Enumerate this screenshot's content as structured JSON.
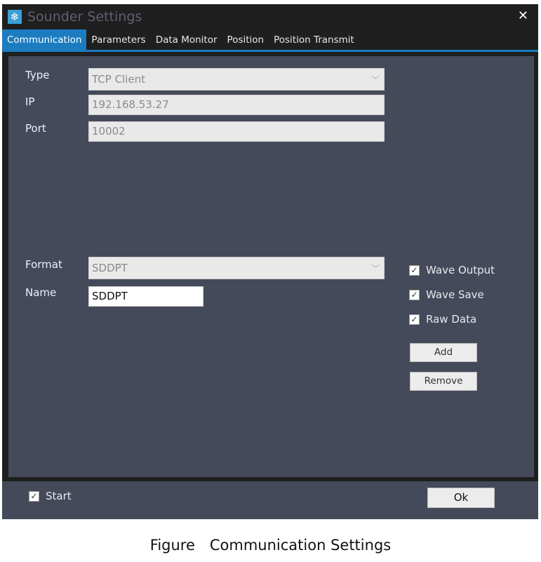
{
  "window": {
    "title": "Sounder Settings",
    "close": "✕",
    "icon": "❄"
  },
  "tabs": [
    {
      "label": "Communication"
    },
    {
      "label": "Parameters"
    },
    {
      "label": "Data Monitor"
    },
    {
      "label": "Position"
    },
    {
      "label": "Position Transmit"
    }
  ],
  "form": {
    "type_label": "Type",
    "type_value": "TCP Client",
    "ip_label": "IP",
    "ip_value": "192.168.53.27",
    "port_label": "Port",
    "port_value": "10002",
    "format_label": "Format",
    "format_value": "SDDPT",
    "name_label": "Name",
    "name_value": "SDDPT"
  },
  "options": {
    "wave_output": "Wave Output",
    "wave_save": "Wave Save",
    "raw_data": "Raw Data",
    "check": "✓"
  },
  "buttons": {
    "add": "Add",
    "remove": "Remove",
    "ok": "Ok"
  },
  "footer": {
    "start": "Start"
  },
  "caption": "Figure Communication Settings"
}
